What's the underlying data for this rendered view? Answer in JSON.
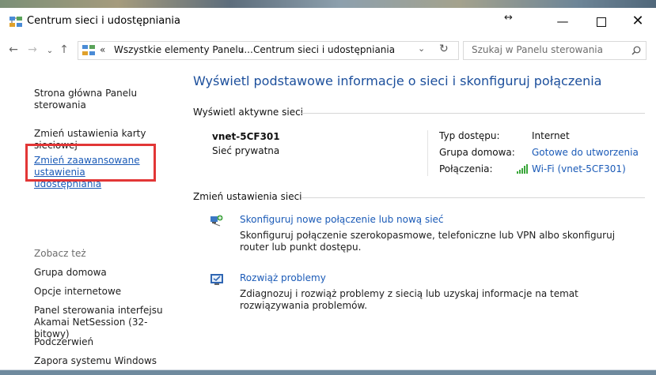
{
  "window": {
    "title": "Centrum sieci i udostępniania",
    "resize_hint": "↔",
    "controls": {
      "minimize": "—",
      "close": "✕"
    }
  },
  "nav": {
    "back": "←",
    "forward": "→",
    "recent": "⌄",
    "up": "↑",
    "address": {
      "chevron": "«",
      "crumbs": [
        "Wszystkie elementy Panelu...",
        "Centrum sieci i udostępniania"
      ],
      "separator": "›",
      "dropdown": "⌄",
      "refresh": "↻"
    },
    "search": {
      "placeholder": "Szukaj w Panelu sterowania"
    }
  },
  "sidebar": {
    "links": [
      {
        "label": "Strona główna Panelu sterowania"
      },
      {
        "label": "Zmień ustawienia karty sieciowej"
      },
      {
        "label": "Zmień zaawansowane ustawienia udostępniania"
      }
    ],
    "see_also_heading": "Zobacz też",
    "see_also": [
      {
        "label": "Grupa domowa"
      },
      {
        "label": "Opcje internetowe"
      },
      {
        "label": "Panel sterowania interfejsu Akamai NetSession (32-bitowy)"
      },
      {
        "label": "Podczerwień"
      },
      {
        "label": "Zapora systemu Windows"
      }
    ]
  },
  "main": {
    "title": "Wyświetl podstawowe informacje o sieci i skonfiguruj połączenia",
    "active_networks": {
      "heading": "Wyświetl aktywne sieci",
      "name": "vnet-5CF301",
      "type": "Sieć prywatna",
      "access_type_label": "Typ dostępu:",
      "access_type": "Internet",
      "homegroup_label": "Grupa domowa:",
      "homegroup": "Gotowe do utworzenia",
      "connections_label": "Połączenia:",
      "connection": "Wi-Fi (vnet-5CF301)"
    },
    "change_settings": {
      "heading": "Zmień ustawienia sieci",
      "tasks": [
        {
          "link": "Skonfiguruj nowe połączenie lub nową sieć",
          "description": "Skonfiguruj połączenie szerokopasmowe, telefoniczne lub VPN albo skonfiguruj router lub punkt dostępu."
        },
        {
          "link": "Rozwiąż problemy",
          "description": "Zdiagnozuj i rozwiąż problemy z siecią lub uzyskaj informacje na temat rozwiązywania problemów."
        }
      ]
    }
  },
  "colors": {
    "link": "#1a5ab7",
    "title": "#1c4f9c",
    "highlight": "#e23636"
  }
}
